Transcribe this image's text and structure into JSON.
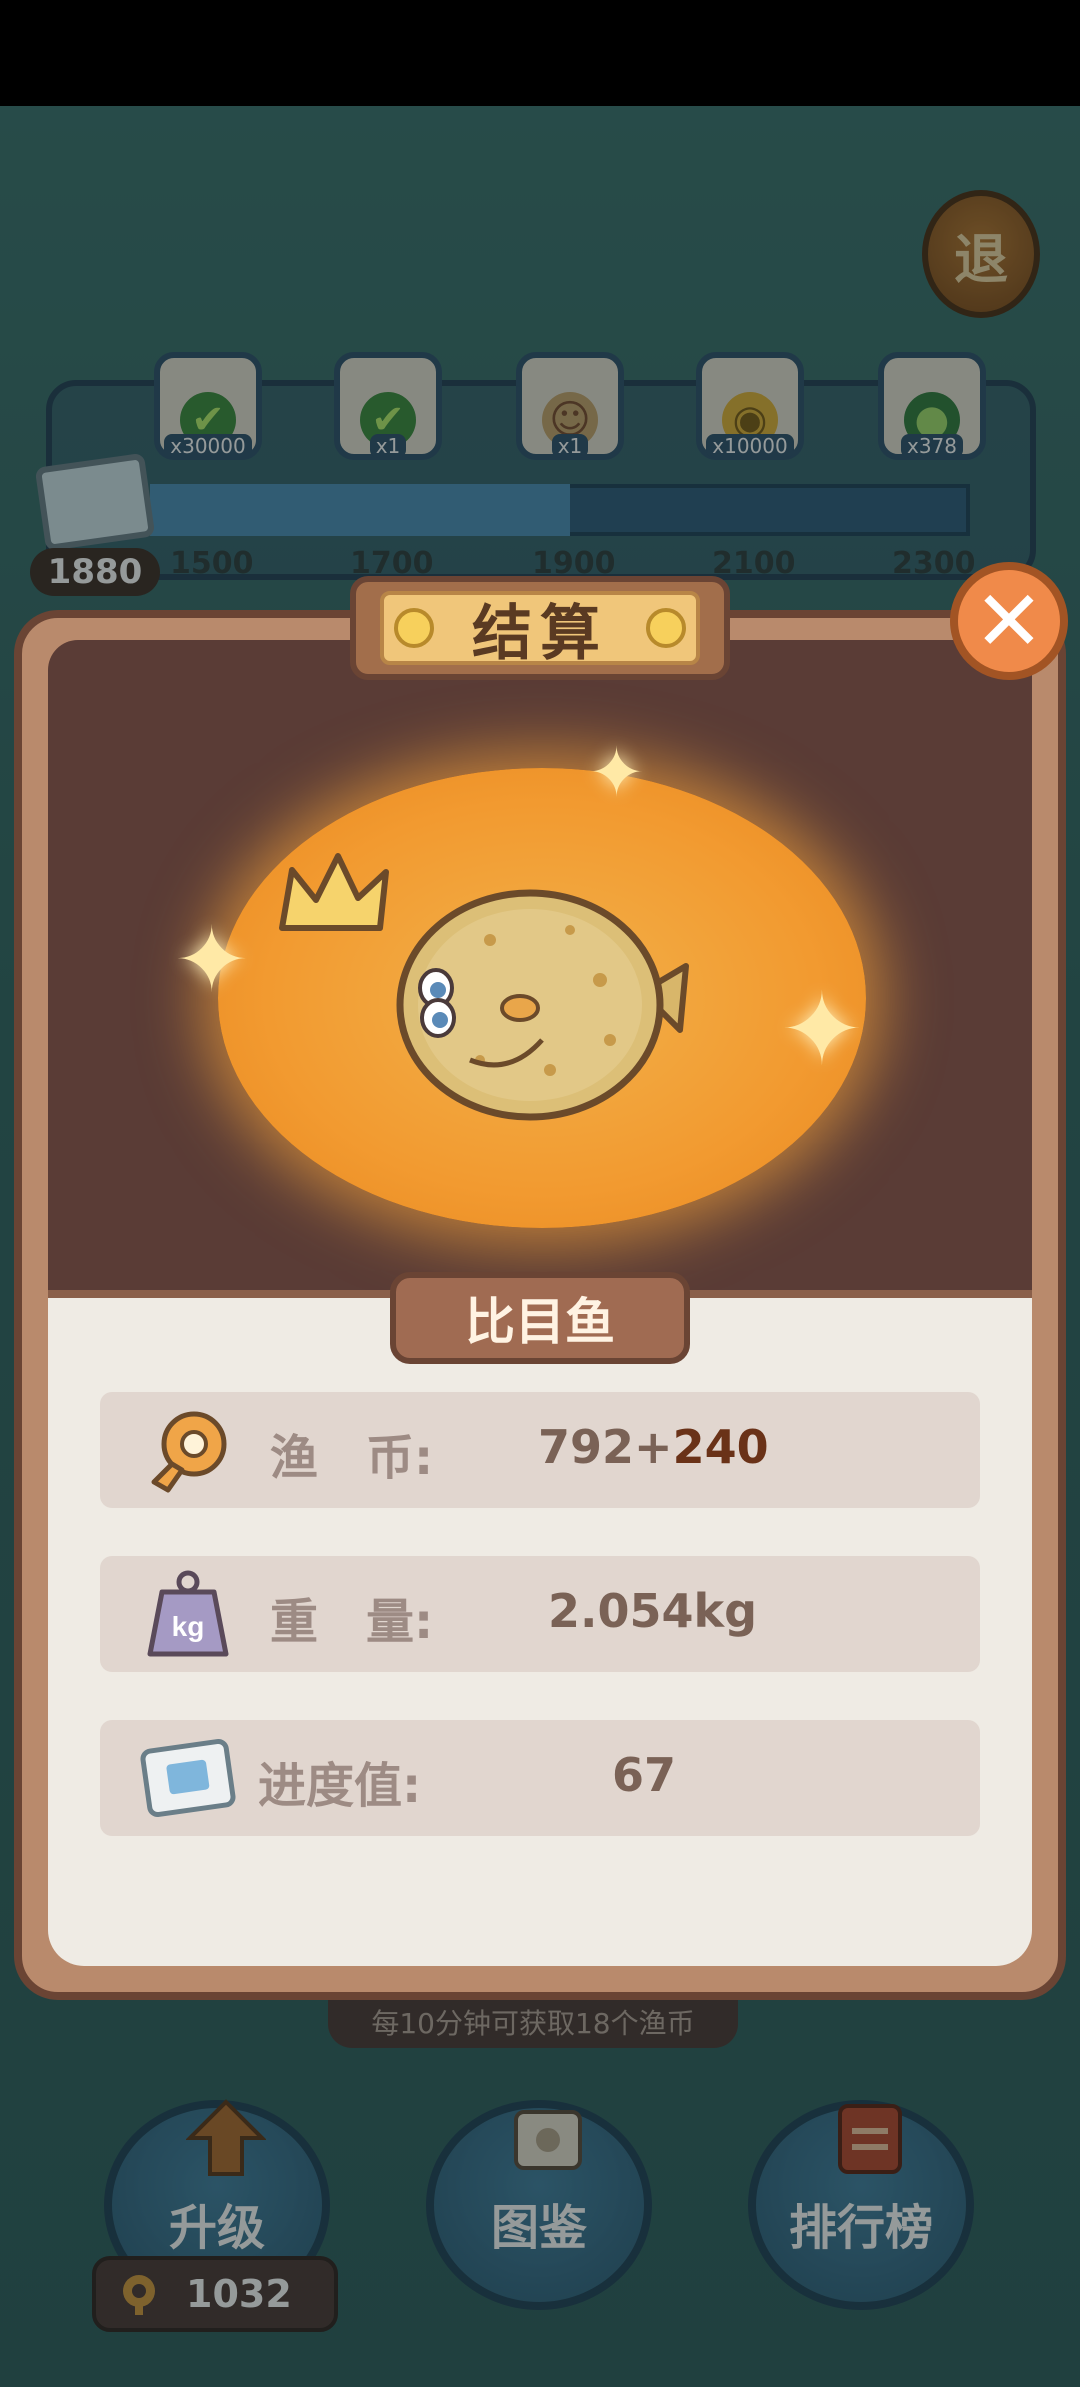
{
  "header": {
    "exit_label": "退"
  },
  "track": {
    "progress_value": "1880",
    "milestones": [
      {
        "icon": "check-chest-icon",
        "qty": "x30000"
      },
      {
        "icon": "check-card-icon",
        "qty": "x1"
      },
      {
        "icon": "character-card-icon",
        "qty": "x1"
      },
      {
        "icon": "gold-coin-icon",
        "qty": "x10000"
      },
      {
        "icon": "green-bottle-icon",
        "qty": "x378"
      }
    ],
    "ticks": [
      "1500",
      "1700",
      "1900",
      "2100",
      "2300"
    ]
  },
  "modal": {
    "title": "结算",
    "fish_name": "比目鱼",
    "stats": [
      {
        "icon": "fish-coin-icon",
        "label": "渔　币:",
        "value": "792+",
        "bonus": "240"
      },
      {
        "icon": "weight-kg-icon",
        "label": "重　量:",
        "value": "2.054kg",
        "bonus": ""
      },
      {
        "icon": "progress-ticket-icon",
        "label": "进度值:",
        "value": "67",
        "bonus": ""
      }
    ]
  },
  "footer": {
    "hint": "每10分钟可获取18个渔币",
    "buttons": [
      {
        "label": "升级",
        "icon": "upgrade-arrow-icon"
      },
      {
        "label": "图鉴",
        "icon": "catalog-book-icon"
      },
      {
        "label": "排行榜",
        "icon": "leaderboard-icon"
      }
    ],
    "coin_count": "1032"
  },
  "colors": {
    "accent_orange": "#f29a30",
    "panel_brown": "#6a4434",
    "close_orange": "#f08a4a"
  }
}
